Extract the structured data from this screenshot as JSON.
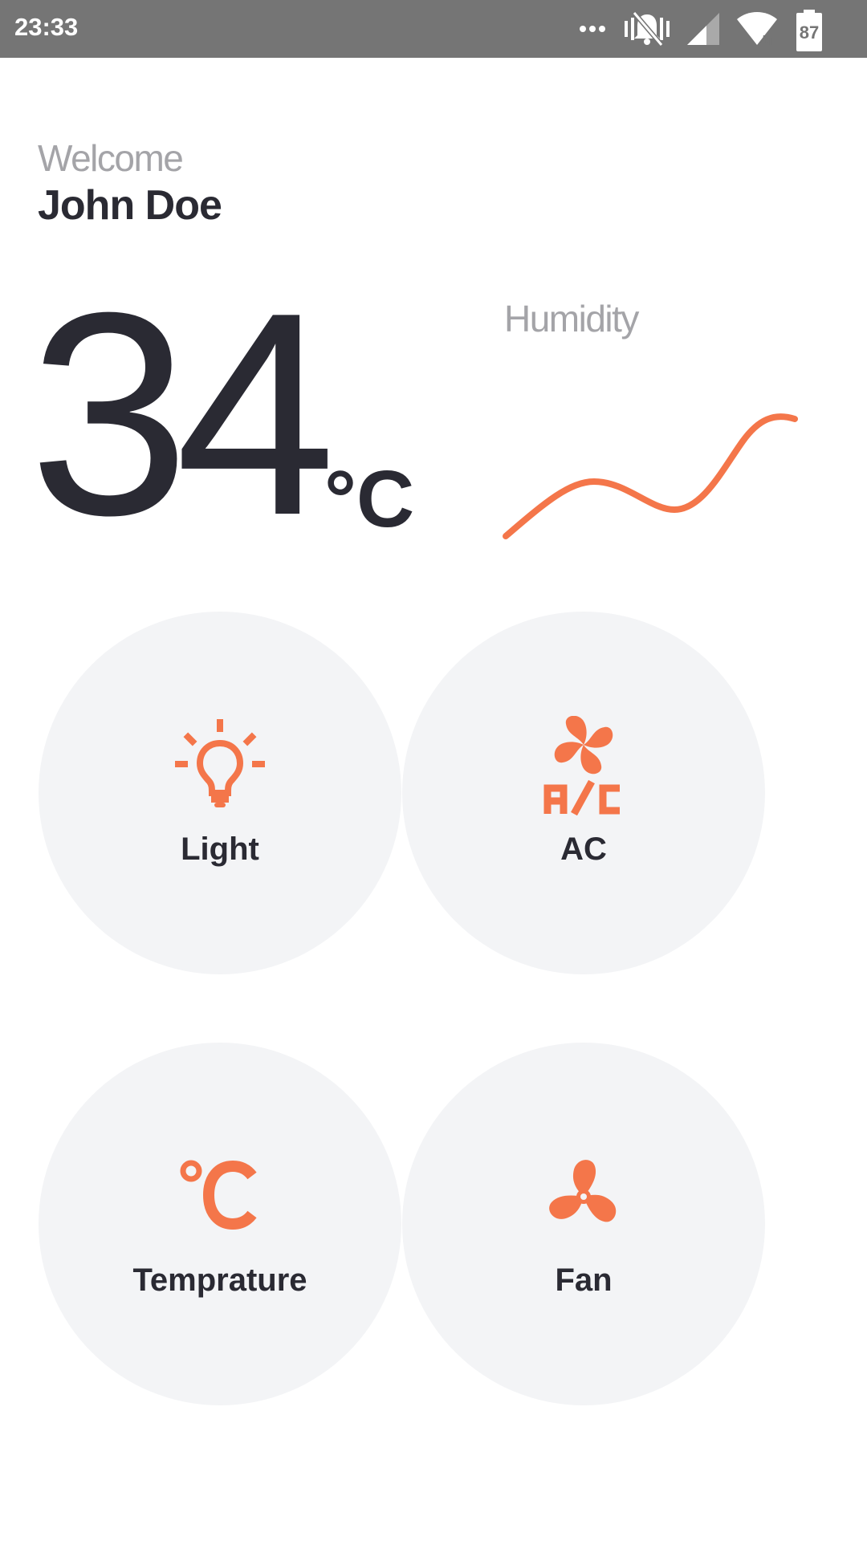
{
  "status_bar": {
    "time": "23:33",
    "battery": "87",
    "icons": [
      "more-dots-icon",
      "vibrate-silent-icon",
      "signal-icon",
      "wifi-icon",
      "battery-icon"
    ]
  },
  "greeting": {
    "welcome": "Welcome",
    "name": "John Doe"
  },
  "temperature": {
    "value": "34",
    "unit": "°C"
  },
  "humidity": {
    "label": "Humidity"
  },
  "controls": [
    {
      "label": "Light",
      "icon": "lightbulb-icon"
    },
    {
      "label": "AC",
      "icon": "ac-fan-icon"
    },
    {
      "label": "Temprature",
      "icon": "celsius-icon"
    },
    {
      "label": "Fan",
      "icon": "fan-icon"
    }
  ],
  "colors": {
    "accent": "#F4764A",
    "text_dark": "#2A2A33",
    "text_muted": "#A4A4A8",
    "tile_bg": "#F3F4F6",
    "status_bar": "#757575"
  }
}
